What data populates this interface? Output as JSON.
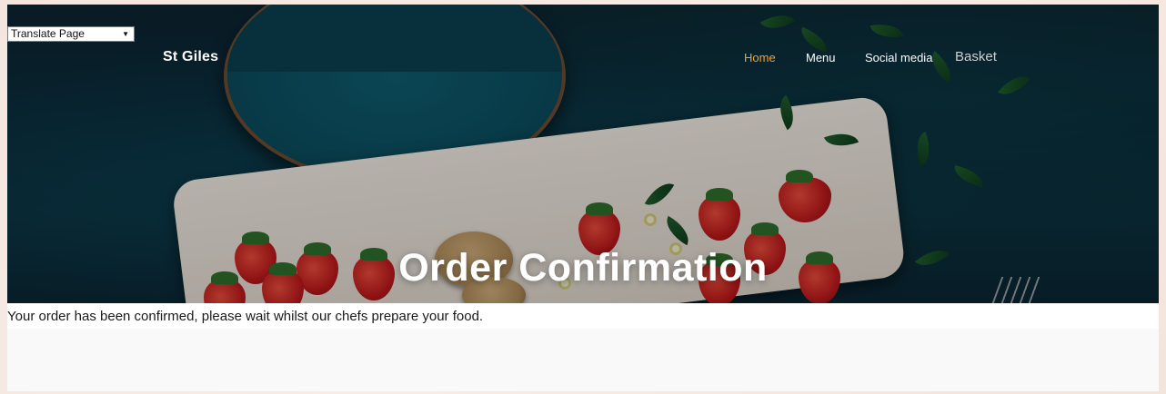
{
  "translate": {
    "selected": "Translate Page"
  },
  "brand": {
    "name": "St Giles"
  },
  "nav": {
    "items": [
      {
        "label": "Home",
        "active": true
      },
      {
        "label": "Menu",
        "active": false
      },
      {
        "label": "Social media",
        "active": false
      },
      {
        "label": "Basket",
        "active": false
      }
    ]
  },
  "hero": {
    "title": "Order Confirmation"
  },
  "main": {
    "message": "Your order has been confirmed, please wait whilst our chefs prepare your food."
  },
  "colors": {
    "accent": "#f0a030",
    "hero_bg": "#0b2f3c",
    "text": "#1a1a1a"
  }
}
